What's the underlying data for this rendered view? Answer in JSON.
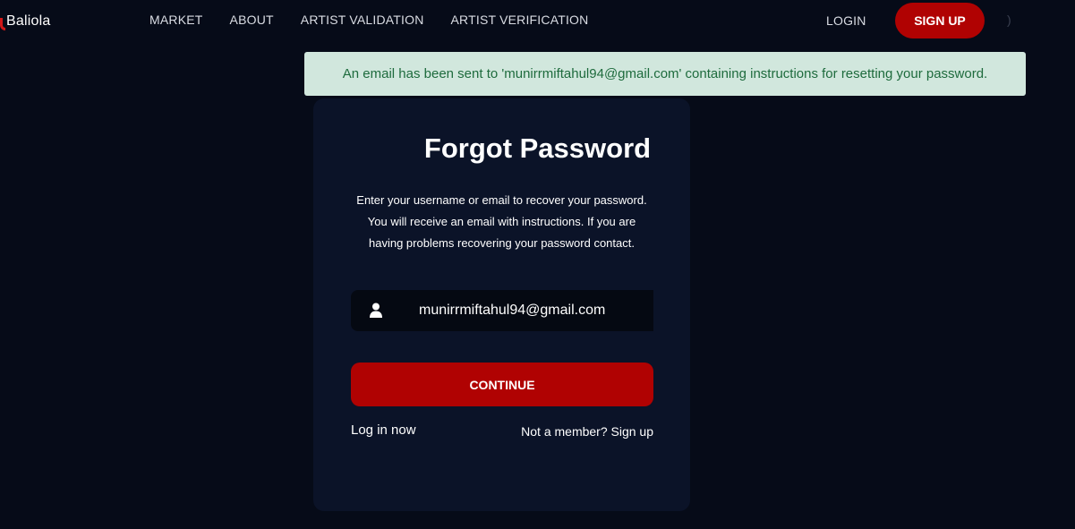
{
  "brand": {
    "name": "Baliola",
    "accent": "#d01818"
  },
  "nav": {
    "items": [
      {
        "label": "MARKET"
      },
      {
        "label": "ABOUT"
      },
      {
        "label": "ARTIST VALIDATION"
      },
      {
        "label": "ARTIST VERIFICATION"
      }
    ],
    "login_label": "LOGIN",
    "signup_label": "SIGN UP",
    "trailing_glyph": ")"
  },
  "alert": {
    "message": "An email has been sent to 'munirrmiftahul94@gmail.com' containing instructions for resetting your password.",
    "background": "#d1e7dd",
    "text_color": "#1e6b3d"
  },
  "form": {
    "title": "Forgot Password",
    "description": "Enter your username or email to recover your password. You will receive an email with instructions. If you are having problems recovering your password contact.",
    "email_icon": "user-icon",
    "email_value": "munirrmiftahul94@gmail.com",
    "continue_label": "CONTINUE",
    "login_now_label": "Log in now",
    "signup_prompt": "Not a member? Sign up"
  },
  "colors": {
    "background": "#060b18",
    "card": "#0b1328",
    "primary_button": "#b00202"
  }
}
